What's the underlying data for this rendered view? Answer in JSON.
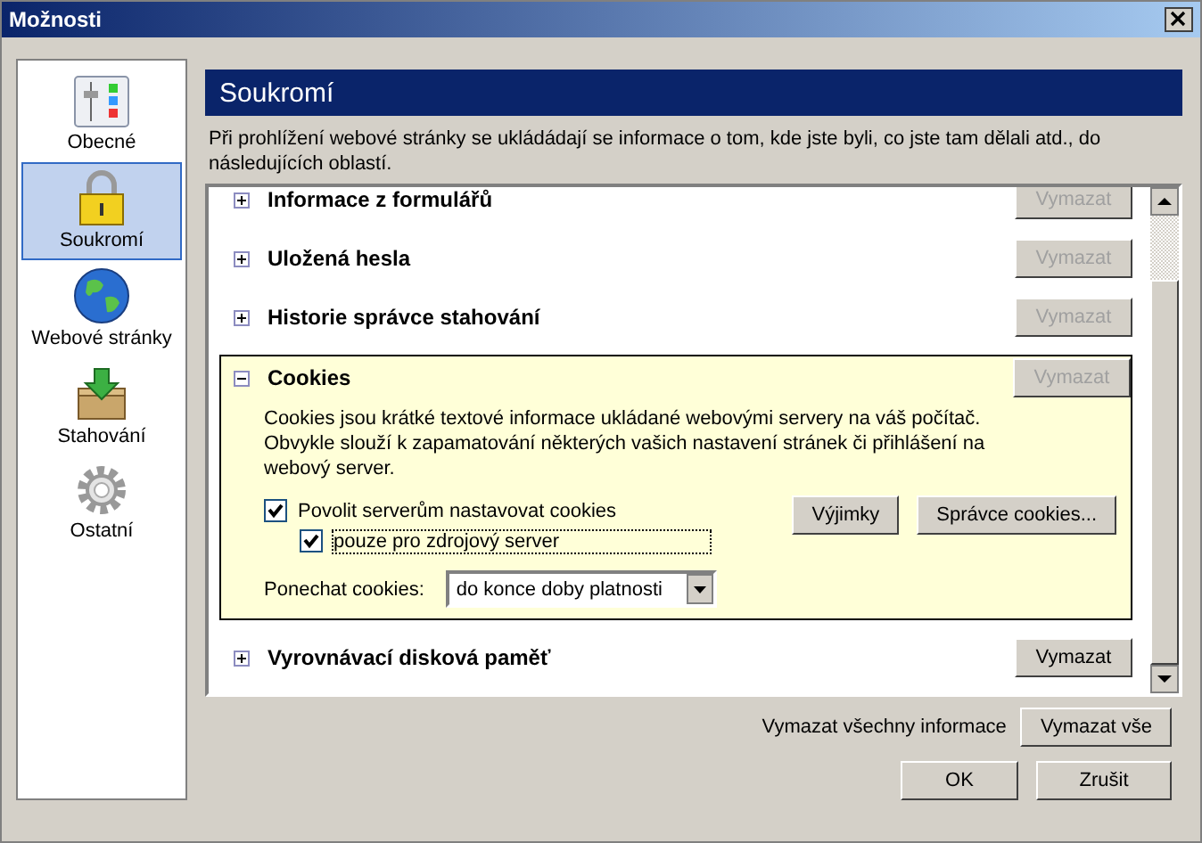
{
  "window": {
    "title": "Možnosti"
  },
  "sidebar": {
    "items": [
      {
        "label": "Obecné",
        "selected": false
      },
      {
        "label": "Soukromí",
        "selected": true
      },
      {
        "label": "Webové stránky",
        "selected": false
      },
      {
        "label": "Stahování",
        "selected": false
      },
      {
        "label": "Ostatní",
        "selected": false
      }
    ]
  },
  "panel": {
    "title": "Soukromí",
    "description": "Při prohlížení webové stránky se ukládádají se informace o tom, kde jste byli, co jste tam dělali atd., do následujících oblastí.",
    "sections": [
      {
        "title": "Informace z formulářů",
        "expanded": false,
        "button": {
          "label": "Vymazat",
          "disabled": true
        }
      },
      {
        "title": "Uložená hesla",
        "expanded": false,
        "button": {
          "label": "Vymazat",
          "disabled": true
        }
      },
      {
        "title": "Historie správce stahování",
        "expanded": false,
        "button": {
          "label": "Vymazat",
          "disabled": true
        }
      },
      {
        "title": "Cookies",
        "expanded": true,
        "button": {
          "label": "Vymazat",
          "disabled": true
        },
        "description": "Cookies jsou krátké textové informace ukládané webovými servery na váš počítač. Obvykle slouží k zapamatování některých vašich nastavení stránek či přihlášení na webový server.",
        "checkboxes": [
          {
            "label": "Povolit serverům nastavovat cookies",
            "checked": true
          },
          {
            "label": "pouze pro zdrojový server",
            "checked": true
          }
        ],
        "buttons": [
          "Výjimky",
          "Správce cookies..."
        ],
        "keep": {
          "label": "Ponechat cookies:",
          "value": "do konce doby platnosti"
        }
      },
      {
        "title": "Vyrovnávací disková paměť",
        "expanded": false,
        "button": {
          "label": "Vymazat",
          "disabled": false
        }
      }
    ]
  },
  "clear_all": {
    "label": "Vymazat všechny informace",
    "button": "Vymazat vše"
  },
  "buttons": [
    "OK",
    "Zrušit"
  ]
}
